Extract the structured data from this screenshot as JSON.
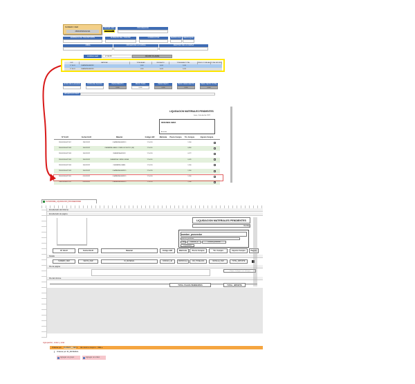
{
  "form": {
    "numero_oer_label": "NUMERO OER",
    "numero_oer_value": "2800105464/22111",
    "fecha_oer_label": "FECHA OER",
    "fecha_oer_value": "01/03/2022",
    "proveedor_label": "PROVEEDOR",
    "empresa_label": "EMPRESA DE TRANSPORTE",
    "albaran_label": "ALBARAN DEL TRANSP.",
    "conductor_label": "CONDUCTOR",
    "matricula_label": "MATRICULA",
    "remolque_label": "REMOLQUE",
    "obra_label": "OBRA",
    "origen_label": "ORIGEN DE LA CARGA",
    "destino_label": "DESTINO DE LA CARGA",
    "codigo_ler_label": "CODIGO LER",
    "codigo_ler_value": "17 04 05",
    "anadir_label": "AÑADIR FILAERE",
    "grid_headers": [
      "LER",
      "MATERIAL",
      "TONELADAS",
      "RECHAZOS",
      "TONELADAS TOTAL",
      "PRECIO TONELADA",
      "TOTAL IMPORTE"
    ],
    "grid_rows": [
      [
        "17 04 05",
        "CHATARRA HIERRO",
        "1,000",
        "0,000",
        "1,000",
        "",
        ""
      ],
      [
        "17 04 05",
        "CHATARRA HIERRO",
        "1,000",
        "0,000",
        "1,000",
        "",
        ""
      ]
    ],
    "bottom": [
      {
        "label": "HORA DE LLEGADA",
        "value": ""
      },
      {
        "label": "HORA DE SALIDA",
        "value": ""
      },
      {
        "label": "PESO BRUTO",
        "value": "0,000"
      },
      {
        "label": "PESO TARA",
        "value": "0,000"
      },
      {
        "label": "PESO NETO",
        "value": "0,000"
      },
      {
        "label": "PESO DESCUENTO",
        "value": "0,000"
      },
      {
        "label": "PESO NETO TOTAL",
        "value": "0,000"
      }
    ],
    "observaciones_label": "OBSERVACIONES"
  },
  "report": {
    "title": "LIQUIDACION MATERIALES PENDIENTES",
    "date": "lunes, 4 de abril de 2022",
    "supplier": "RESUMEN OBRA",
    "supplier_sub": "Acreedor",
    "headers": [
      "Nº O.E.R",
      "Fecha O.E.R",
      "Material",
      "Código LER",
      "Matrícula",
      "Precio Compra",
      "Tm. Compra",
      "Importe Compra"
    ],
    "rows": [
      [
        "2800105464/22107",
        "28/02/2022",
        "CHATARRA HIERRO",
        "17 04 05",
        "",
        "",
        "1,560",
        ""
      ],
      [
        "2800105464/22108",
        "30/03/2022",
        "CHATARRA CABLE COBRE S/CUB PVC (68)",
        "17 04 01",
        "",
        "",
        "0,860",
        ""
      ],
      [
        "2800105464/22108",
        "30/03/2022",
        "CHATARRA ACERO",
        "17 04 05",
        "",
        "",
        "0,272",
        ""
      ],
      [
        "2800105464/22108",
        "30/03/2022",
        "CHATARRA COBRE DUERA",
        "17 04 01",
        "",
        "",
        "0,029",
        ""
      ],
      [
        "2800105464/22108",
        "30/03/2022",
        "CHATARRA CABEL",
        "17 04 05",
        "",
        "",
        "1,560",
        ""
      ],
      [
        "2800105464/22108",
        "30/03/2022",
        "CHATARRA HIERRO",
        "17 04 05",
        "",
        "",
        "1,560",
        ""
      ],
      [
        "2800105464/22109",
        "01/03/2022",
        "CHATARRA HIERRO",
        "17 04 05",
        "",
        "",
        "1,560",
        ""
      ],
      [
        "2800105464/22111",
        "01/03/2022",
        "CHATARRA HIERRO",
        "17 04 05",
        "",
        "",
        "1,000",
        ""
      ]
    ]
  },
  "design": {
    "tab": "01-INFORME_LIQUIDACION_PROVEEDORES",
    "sec_report_header": "Encabezado del informe",
    "sec_page_header": "Encabezado de página",
    "sec_detail": "Detalle",
    "sec_page_footer": "Pie de página",
    "sec_report_footer": "Pie del informe",
    "title": "LIQUIDACION MATERIALES PENDIENTES",
    "fecha": "=Fecha()",
    "nombre": "nombre_proveedor",
    "direccion": "Direccion_proveedor",
    "cp": "Códig",
    "poblacion": "Poblacion_p",
    "provincia": "Provincia_proveedor",
    "cif": "cif_proveedor",
    "headers": [
      "Nº O.E.R",
      "Fecha O.E.R",
      "Material",
      "Código LER",
      "Matrícula",
      "Precio Compra",
      "Tm. Compra",
      "Importe Compra",
      "Pagado"
    ],
    "fields": [
      "NUMERO_OER",
      "FECHA_OER",
      "ID_MATERIAL",
      "CODIGO_LEI",
      "MATRICULA",
      "CID_TONELADA",
      "DETALLE_OER",
      "TOTAL_IMPORTE"
    ],
    "page_expr": "=\"Página \" & [Page] & \" de \" & [Pages]",
    "total_label": "TOTAL PAGOS PENDIENTES",
    "total_field": "TOTAL_IMPORTE"
  },
  "grouping": {
    "title": "Agrupación, orden y total",
    "sort1_prefix": "Ordenar por",
    "sort1_field": "NUMERO_OER",
    "sort1_order": "de menor a mayor",
    "sort1_more": "Más ▸",
    "sort2_prefix": "Ordenar por",
    "sort2_field": "ID_MATERIAL",
    "add_group": "Agregar un grupo",
    "add_order": "Agregar un orden"
  },
  "colors": {
    "accent": "#3f6cb4",
    "highlight": "#ffe600",
    "arrow": "#d81818",
    "orange": "#f5a540"
  }
}
